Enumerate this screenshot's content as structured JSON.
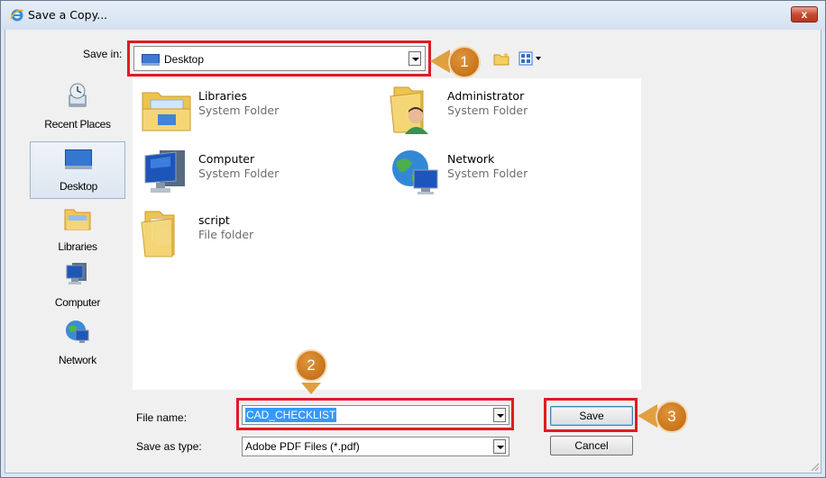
{
  "window": {
    "title": "Save a Copy...",
    "close_label": "x"
  },
  "save_in": {
    "label": "Save in:",
    "value": "Desktop"
  },
  "places": [
    {
      "label": "Recent Places",
      "icon": "recent-places-icon"
    },
    {
      "label": "Desktop",
      "icon": "desktop-icon",
      "selected": true
    },
    {
      "label": "Libraries",
      "icon": "libraries-icon"
    },
    {
      "label": "Computer",
      "icon": "computer-icon"
    },
    {
      "label": "Network",
      "icon": "network-icon"
    }
  ],
  "files": [
    {
      "name": "Libraries",
      "type": "System Folder",
      "icon": "libraries-folder-icon"
    },
    {
      "name": "Administrator",
      "type": "System Folder",
      "icon": "user-folder-icon"
    },
    {
      "name": "Computer",
      "type": "System Folder",
      "icon": "computer-icon"
    },
    {
      "name": "Network",
      "type": "System Folder",
      "icon": "network-globe-icon"
    },
    {
      "name": "script",
      "type": "File folder",
      "icon": "folder-icon"
    }
  ],
  "file_name": {
    "label": "File name:",
    "value": "CAD_CHECKLIST"
  },
  "save_as_type": {
    "label": "Save as type:",
    "value": "Adobe PDF Files (*.pdf)"
  },
  "buttons": {
    "save": "Save",
    "cancel": "Cancel"
  },
  "callouts": [
    "1",
    "2",
    "3"
  ],
  "colors": {
    "highlight": "#e01b24",
    "callout": "#c8741a",
    "selection": "#3399ff"
  }
}
